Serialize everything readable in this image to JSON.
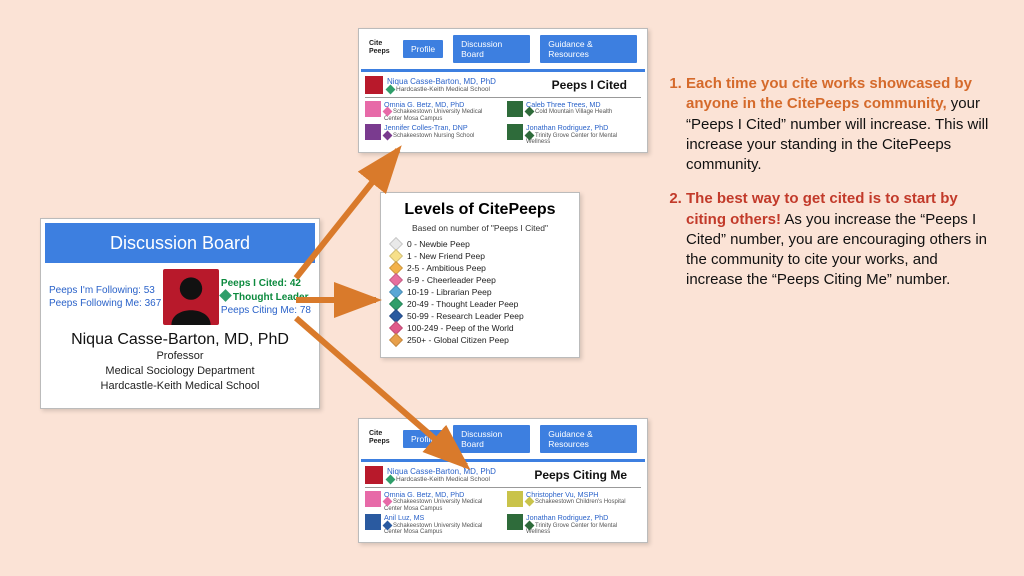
{
  "profile": {
    "header": "Discussion Board",
    "stats_left": [
      {
        "label": "Peeps I'm Following:",
        "value": "53"
      },
      {
        "label": "Peeps Following Me:",
        "value": "367"
      }
    ],
    "stats_right": [
      {
        "label": "Peeps I Cited:",
        "value": "42",
        "cls": "green"
      },
      {
        "label": "Thought Leader",
        "value": "",
        "cls": "green"
      },
      {
        "label": "Peeps Citing Me:",
        "value": "78"
      }
    ],
    "name": "Niqua Casse-Barton, MD, PhD",
    "title": "Professor",
    "dept": "Medical Sociology Department",
    "school": "Hardcastle-Keith Medical School"
  },
  "nav": {
    "logo": "Cite Peeps",
    "tabs": [
      "Profile",
      "Discussion Board",
      "Guidance & Resources"
    ]
  },
  "cited_panel": {
    "me_name": "Niqua Casse-Barton, MD, PhD",
    "me_sub": "Hardcastle-Keith Medical School",
    "title": "Peeps I Cited",
    "peeps": [
      {
        "n": "Omnia G. Betz, MD, PhD",
        "s": "Schakeestown University Medical Center Mosa Campus",
        "c": "#e76aa8"
      },
      {
        "n": "Caleb Three Trees, MD",
        "s": "Cold Mountain Village Health",
        "c": "#2e6b3a"
      },
      {
        "n": "Jennifer Colles-Tran, DNP",
        "s": "Schakeestown Nursing School",
        "c": "#7a3b8f"
      },
      {
        "n": "Jonathan Rodriguez, PhD",
        "s": "Trinity Grove Center for Mental Wellness",
        "c": "#2e6b3a"
      }
    ]
  },
  "citing_panel": {
    "me_name": "Niqua Casse-Barton, MD, PhD",
    "me_sub": "Hardcastle-Keith Medical School",
    "title": "Peeps Citing Me",
    "peeps": [
      {
        "n": "Omnia G. Betz, MD, PhD",
        "s": "Schakeestown University Medical Center Mosa Campus",
        "c": "#e76aa8"
      },
      {
        "n": "Christopher Vu, MSPH",
        "s": "Schakeestown Children's Hospital",
        "c": "#c9c34a"
      },
      {
        "n": "Anil Luz, MS",
        "s": "Schakeestown University Medical Center Mosa Campus",
        "c": "#2a5aa0"
      },
      {
        "n": "Jonathan Rodriguez, PhD",
        "s": "Trinity Grove Center for Mental Wellness",
        "c": "#2e6b3a"
      }
    ]
  },
  "levels": {
    "title": "Levels of CitePeeps",
    "sub": "Based on number of \"Peeps I Cited\"",
    "rows": [
      {
        "c": "#e9e9e9",
        "t": "0 - Newbie Peep"
      },
      {
        "c": "#f7e08a",
        "t": "1 - New Friend Peep"
      },
      {
        "c": "#f3b24a",
        "t": "2-5 - Ambitious Peep"
      },
      {
        "c": "#e86f9e",
        "t": "6-9 - Cheerleader Peep"
      },
      {
        "c": "#5aa7d6",
        "t": "10-19 - Librarian Peep"
      },
      {
        "c": "#2f9e6a",
        "t": "20-49 - Thought Leader Peep"
      },
      {
        "c": "#2a5aa0",
        "t": "50-99 - Research Leader Peep"
      },
      {
        "c": "#e05a8a",
        "t": "100-249 - Peep of the World"
      },
      {
        "c": "#e8a04a",
        "t": "250+ - Global Citizen Peep"
      }
    ]
  },
  "text": {
    "li1_lead": "Each time you cite works showcased by anyone in the CitePeeps community,",
    "li1_rest": " your “Peeps I Cited” number will increase. This will increase your standing in the CitePeeps community.",
    "li2_lead": "The best way to get cited is to start by citing others!",
    "li2_rest": " As you increase the “Peeps I Cited” number, you are encouraging others in the community to cite your works, and increase the “Peeps Citing Me” number."
  }
}
